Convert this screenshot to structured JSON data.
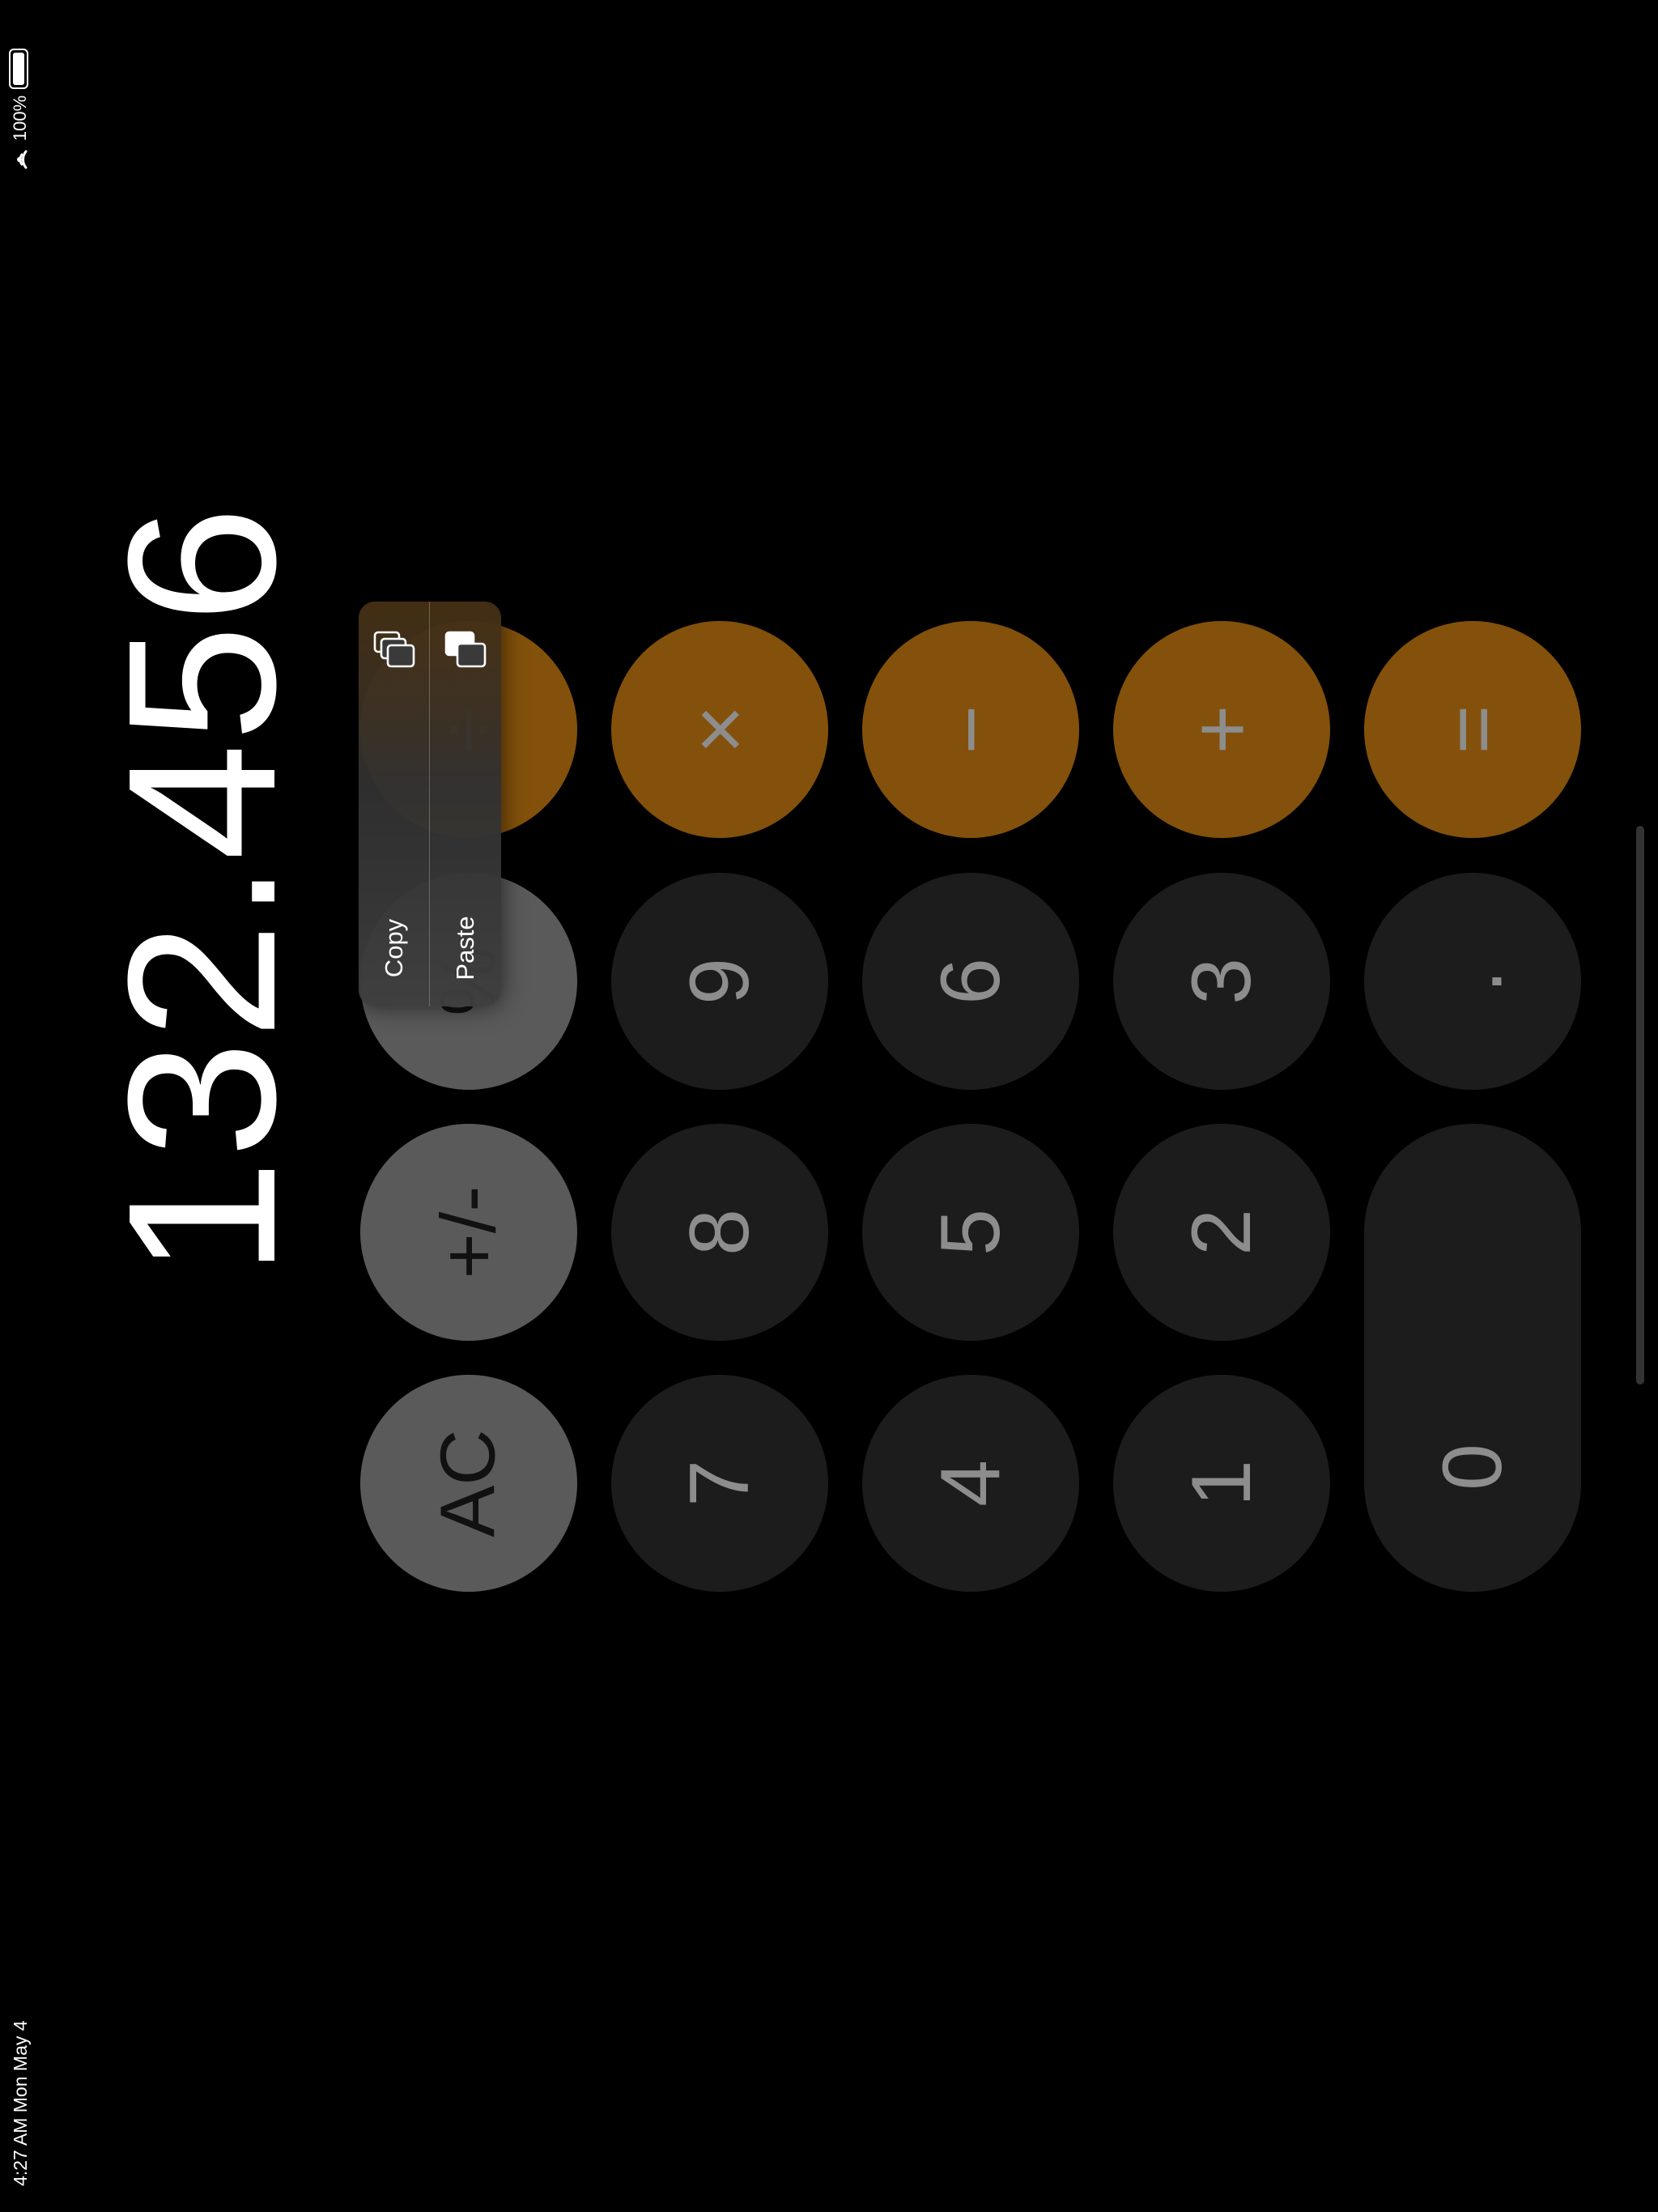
{
  "status_bar": {
    "time_date": "4:27 AM   Mon May 4",
    "battery_percent": "100%",
    "icons": [
      "wifi-icon",
      "battery-icon"
    ]
  },
  "display": {
    "value": "132.456"
  },
  "keypad": {
    "rows": [
      [
        {
          "label": "AC",
          "name": "clear"
        },
        {
          "label": "+/-",
          "name": "sign"
        },
        {
          "label": "%",
          "name": "percent"
        },
        {
          "label": "÷",
          "name": "divide"
        }
      ],
      [
        {
          "label": "7",
          "name": "7"
        },
        {
          "label": "8",
          "name": "8"
        },
        {
          "label": "9",
          "name": "9"
        },
        {
          "label": "×",
          "name": "multiply"
        }
      ],
      [
        {
          "label": "4",
          "name": "4"
        },
        {
          "label": "5",
          "name": "5"
        },
        {
          "label": "6",
          "name": "6"
        },
        {
          "label": "−",
          "name": "minus"
        }
      ],
      [
        {
          "label": "1",
          "name": "1"
        },
        {
          "label": "2",
          "name": "2"
        },
        {
          "label": "3",
          "name": "3"
        },
        {
          "label": "+",
          "name": "plus"
        }
      ],
      [
        {
          "label": "0",
          "name": "0"
        },
        {
          "label": ".",
          "name": "decimal"
        },
        {
          "label": "=",
          "name": "equals"
        }
      ]
    ]
  },
  "context_menu": {
    "copy": "Copy",
    "paste": "Paste",
    "icons": [
      "copy-icon",
      "paste-icon"
    ]
  },
  "colors": {
    "background": "#000000",
    "function_key": "#5a5a5a",
    "number_key": "#1c1c1c",
    "operator_key": "#83510b",
    "key_text": "#8d8d8d"
  }
}
